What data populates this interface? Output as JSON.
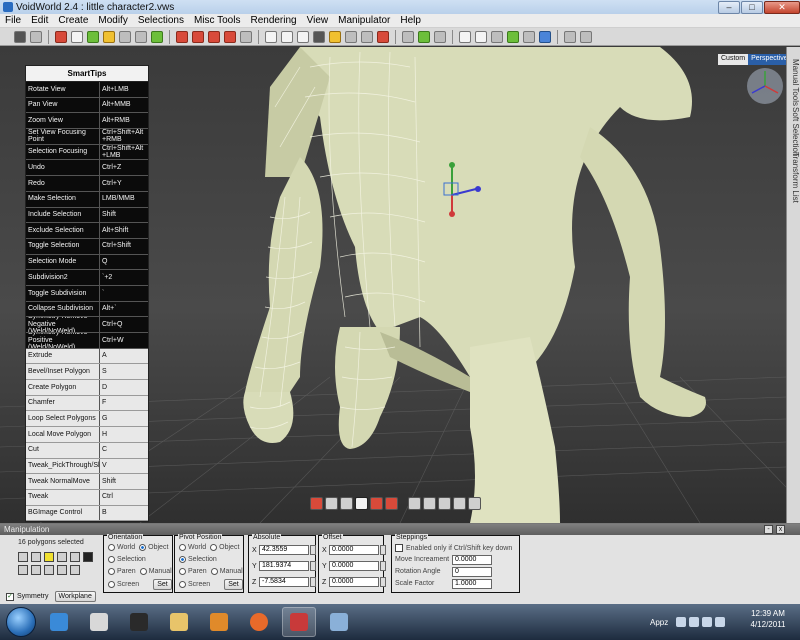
{
  "window": {
    "title": "VoidWorld 2.4 : little character2.vws",
    "controls": [
      "minimize",
      "maximize",
      "close"
    ]
  },
  "menubar": [
    "File",
    "Edit",
    "Create",
    "Modify",
    "Selections",
    "Misc Tools",
    "Rendering",
    "View",
    "Manipulator",
    "Help"
  ],
  "viewport": {
    "label_custom": "Custom",
    "label_perspective": "Perspective"
  },
  "side_tabs": [
    "Manual Tools",
    "Soft Selection",
    "Transform List"
  ],
  "smarttips": {
    "title": "SmartTips",
    "rows": [
      {
        "action": "Rotate View",
        "key": "Alt+LMB",
        "style": "dark"
      },
      {
        "action": "Pan View",
        "key": "Alt+MMB",
        "style": "dark"
      },
      {
        "action": "Zoom View",
        "key": "Alt+RMB",
        "style": "dark"
      },
      {
        "action": "Set View Focusing Point",
        "key": "Ctrl+Shift+Alt +RMB",
        "style": "dark"
      },
      {
        "action": "Selection Focusing",
        "key": "Ctrl+Shift+Alt +LMB",
        "style": "dark"
      },
      {
        "action": "Undo",
        "key": "Ctrl+Z",
        "style": "dark"
      },
      {
        "action": "Redo",
        "key": "Ctrl+Y",
        "style": "dark"
      },
      {
        "action": "Make Selection",
        "key": "LMB/MMB",
        "style": "dark"
      },
      {
        "action": "Include Selection",
        "key": "Shift",
        "style": "dark"
      },
      {
        "action": "Exclude Selection",
        "key": "Alt+Shift",
        "style": "dark"
      },
      {
        "action": "Toggle Selection",
        "key": "Ctrl+Shift",
        "style": "dark"
      },
      {
        "action": "Selection Mode",
        "key": "Q",
        "style": "dark"
      },
      {
        "action": "Subdivision2",
        "key": "`+2",
        "style": "dark"
      },
      {
        "action": "Toggle Subdivision",
        "key": "`",
        "style": "dark"
      },
      {
        "action": "Collapse Subdivision",
        "key": "Alt+`",
        "style": "dark"
      },
      {
        "action": "Symmetry Remove-Negative (Weld/NoWeld)",
        "key": "Ctrl+Q",
        "style": "dark"
      },
      {
        "action": "Symmetry Remove-Positive (Weld/NoWeld)",
        "key": "Ctrl+W",
        "style": "dark"
      },
      {
        "action": "Extrude",
        "key": "A",
        "style": "light"
      },
      {
        "action": "Bevel/Inset Polygon",
        "key": "S",
        "style": "light"
      },
      {
        "action": "Create Polygon",
        "key": "D",
        "style": "light"
      },
      {
        "action": "Chamfer",
        "key": "F",
        "style": "light"
      },
      {
        "action": "Loop Select Polygons",
        "key": "G",
        "style": "light"
      },
      {
        "action": "Local Move Polygon",
        "key": "H",
        "style": "light"
      },
      {
        "action": "Cut",
        "key": "C",
        "style": "light"
      },
      {
        "action": "Tweak_PickThrough/SlideSelection",
        "key": "V",
        "style": "light"
      },
      {
        "action": "Tweak NormalMove",
        "key": "Shift",
        "style": "light"
      },
      {
        "action": "Tweak",
        "key": "Ctrl",
        "style": "light"
      },
      {
        "action": "BGImage Control",
        "key": "B",
        "style": "light"
      }
    ]
  },
  "manipulation": {
    "title": "Manipulation",
    "poly_count": "16 polygons selected",
    "symmetry_label": "Symmetry",
    "workplane_button": "Workplane",
    "orientation": {
      "title": "Orientation",
      "world": "World",
      "object": "Object",
      "selection": "Selection",
      "paren": "Paren",
      "manual": "Manual",
      "screen": "Screen",
      "set": "Set"
    },
    "pivot": {
      "title": "Pivot Position",
      "world": "World",
      "object": "Object",
      "selection": "Selection",
      "paren": "Paren",
      "manual": "Manual",
      "screen": "Screen",
      "set": "Set"
    },
    "absolute": {
      "title": "Absolute",
      "x": "42.3559",
      "y": "181.9374",
      "z": "-7.5834"
    },
    "offset": {
      "title": "Offset",
      "x": "0.0000",
      "y": "0.0000",
      "z": "0.0000"
    },
    "steppings": {
      "title": "Steppings",
      "enabled_label": "Enabled only if Ctrl/Shift key down",
      "move_label": "Move Increament",
      "move_value": "0.0000",
      "rotation_label": "Rotation Angle",
      "rotation_value": "0",
      "scale_label": "Scale Factor",
      "scale_value": "1.0000"
    }
  },
  "taskbar": {
    "tray_label": "Appz",
    "time": "12:39 AM",
    "date": "4/12/2011"
  }
}
